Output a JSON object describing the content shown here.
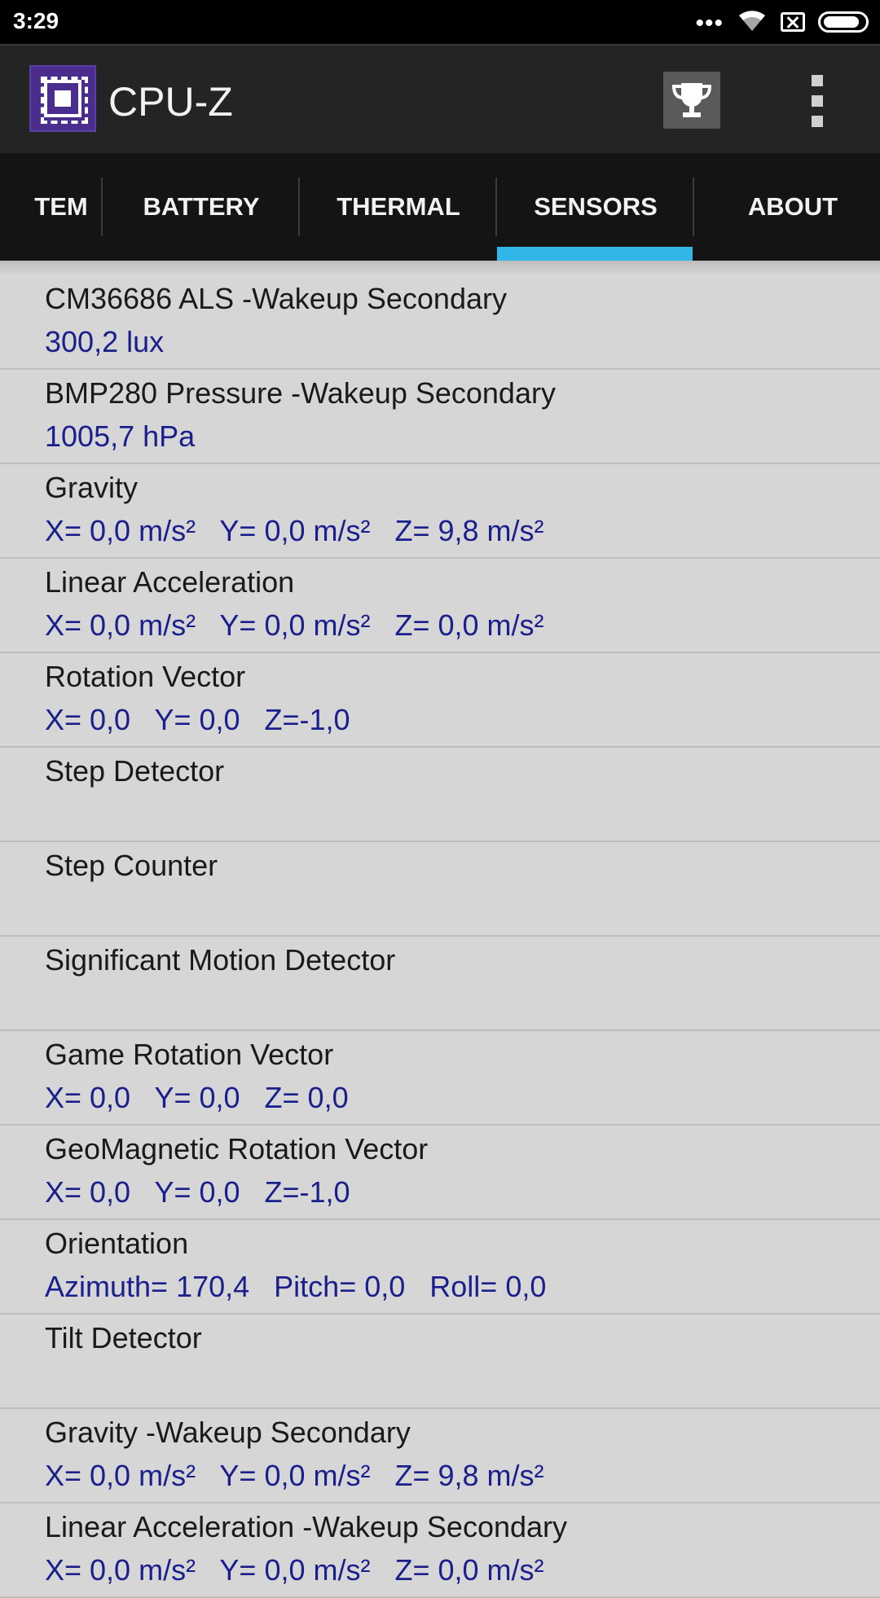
{
  "status_bar": {
    "time": "3:29",
    "dots": "•••"
  },
  "app": {
    "title": "CPU-Z"
  },
  "tabs": [
    {
      "label": "TEM"
    },
    {
      "label": "BATTERY"
    },
    {
      "label": "THERMAL"
    },
    {
      "label": "SENSORS",
      "selected": true
    },
    {
      "label": "ABOUT"
    }
  ],
  "sensors": [
    {
      "name": "CM36686 ALS -Wakeup Secondary",
      "value": "300,2 lux"
    },
    {
      "name": "BMP280 Pressure -Wakeup Secondary",
      "value": "1005,7 hPa"
    },
    {
      "name": "Gravity",
      "value": "X= 0,0 m/s²   Y= 0,0 m/s²   Z= 9,8 m/s²"
    },
    {
      "name": "Linear Acceleration",
      "value": "X= 0,0 m/s²   Y= 0,0 m/s²   Z= 0,0 m/s²"
    },
    {
      "name": "Rotation Vector",
      "value": "X= 0,0   Y= 0,0   Z=-1,0"
    },
    {
      "name": "Step Detector",
      "value": ""
    },
    {
      "name": "Step Counter",
      "value": ""
    },
    {
      "name": "Significant Motion Detector",
      "value": ""
    },
    {
      "name": "Game Rotation Vector",
      "value": "X= 0,0   Y= 0,0   Z= 0,0"
    },
    {
      "name": "GeoMagnetic Rotation Vector",
      "value": "X= 0,0   Y= 0,0   Z=-1,0"
    },
    {
      "name": "Orientation",
      "value": "Azimuth= 170,4   Pitch= 0,0   Roll= 0,0"
    },
    {
      "name": "Tilt Detector",
      "value": ""
    },
    {
      "name": "Gravity -Wakeup Secondary",
      "value": "X= 0,0 m/s²   Y= 0,0 m/s²   Z= 9,8 m/s²"
    },
    {
      "name": "Linear Acceleration -Wakeup Secondary",
      "value": "X= 0,0 m/s²   Y= 0,0 m/s²   Z= 0,0 m/s²"
    }
  ],
  "colors": {
    "tab_indicator": "#31b6e7",
    "value_text": "#1a1f8c",
    "list_background": "#d6d6d6",
    "app_bar": "#242424",
    "tab_bar": "#141414"
  },
  "battery": {
    "level": 0.9
  }
}
